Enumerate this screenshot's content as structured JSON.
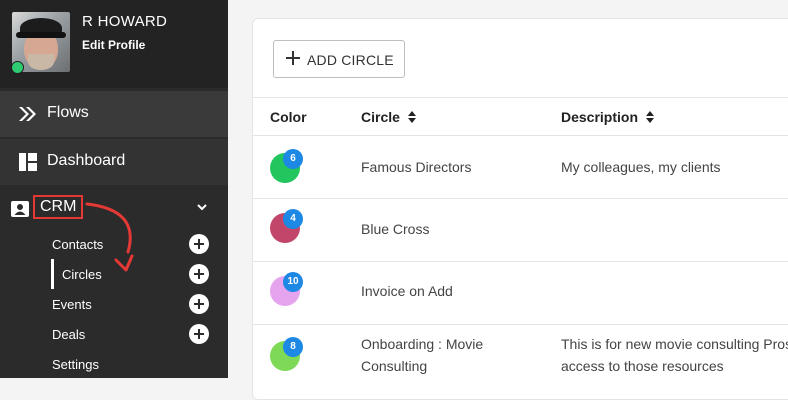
{
  "profile": {
    "name": "R HOWARD",
    "edit_label": "Edit Profile"
  },
  "nav": {
    "flows": "Flows",
    "dashboard": "Dashboard",
    "crm": "CRM",
    "crm_items": [
      "Contacts",
      "Circles",
      "Events",
      "Deals",
      "Settings"
    ]
  },
  "toolbar": {
    "add_label": "ADD CIRCLE"
  },
  "table": {
    "headers": {
      "color": "Color",
      "circle": "Circle",
      "description": "Description"
    },
    "rows": [
      {
        "count": "6",
        "color": "#22c55e",
        "circle": "Famous Directors",
        "description": "My colleagues, my clients"
      },
      {
        "count": "4",
        "color": "#c2466a",
        "circle": "Blue Cross",
        "description": ""
      },
      {
        "count": "10",
        "color": "#e7a4ee",
        "circle": "Invoice on Add",
        "description": ""
      },
      {
        "count": "8",
        "color": "#7ed957",
        "circle_line1": "Onboarding : Movie",
        "circle_line2": "Consulting",
        "desc_line1": "This is for new movie consulting Pros",
        "desc_line2": "access to those resources"
      }
    ]
  },
  "colors": {
    "sidebar": "#2b2b2b",
    "badge": "#1e88e5",
    "annotation": "#e53935"
  }
}
